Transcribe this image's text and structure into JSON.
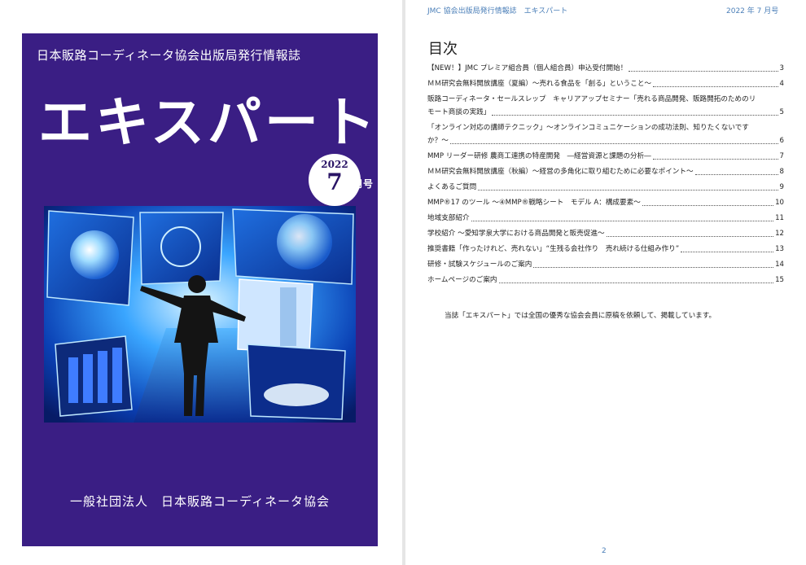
{
  "cover": {
    "subtitle": "日本販路コーディネータ協会出版局発行情報誌",
    "title": "エキスパート",
    "issue_year": "2022",
    "issue_month": "7",
    "issue_suffix": "月号",
    "publisher": "一般社団法人　日本販路コーディネータ協会",
    "background_color": "#3a1e84"
  },
  "header": {
    "left": "JMC 協会出版局発行情報誌　エキスパート",
    "right": "2022 年 7 月号"
  },
  "toc": {
    "heading": "目次",
    "items": [
      {
        "text": "【NEW！】JMC プレミア組合員（個人組合員）申込受付開始！",
        "page": "3"
      },
      {
        "text": "ＭＭ研究会無料開放講座（夏編）～売れる食品を「創る」ということ～",
        "page": "4"
      },
      {
        "text_first": "販路コーディネータ・セールスレップ　キャリアアップセミナー「売れる商品開発、販路開拓のためのリ",
        "text": "モート商談の実践」",
        "page": "5"
      },
      {
        "text_first": "「オンライン対応の講師テクニック」～オンラインコミュニケーションの成功法則、知りたくないです",
        "text": "か？～",
        "page": "6"
      },
      {
        "text": "MMP リーダー研修 農商工連携の特産開発　―経営資源と課題の分析―",
        "page": "7"
      },
      {
        "text": "ＭＭ研究会無料開放講座（秋編）～経営の多角化に取り組むために必要なポイント～",
        "page": "8"
      },
      {
        "text": "よくあるご質問",
        "page": "9"
      },
      {
        "text": "MMP®17 のツール ～④MMP®戦略シート　モデル A：構成要素～",
        "page": "10"
      },
      {
        "text": "地域支部紹介",
        "page": "11"
      },
      {
        "text": "学校紹介 ～愛知学泉大学における商品開発と販売促進～",
        "page": "12"
      },
      {
        "text": "推奨書籍「作ったけれど、売れない」“生残る会社作り　売れ続ける仕組み作り”",
        "page": "13"
      },
      {
        "text": "研修・試験スケジュールのご案内",
        "page": "14"
      },
      {
        "text": "ホームページのご案内",
        "page": "15"
      }
    ]
  },
  "intro": "当誌「エキスパート」では全国の優秀な協会会員に原稿を依頼して、掲載しています。",
  "page_number": "2"
}
